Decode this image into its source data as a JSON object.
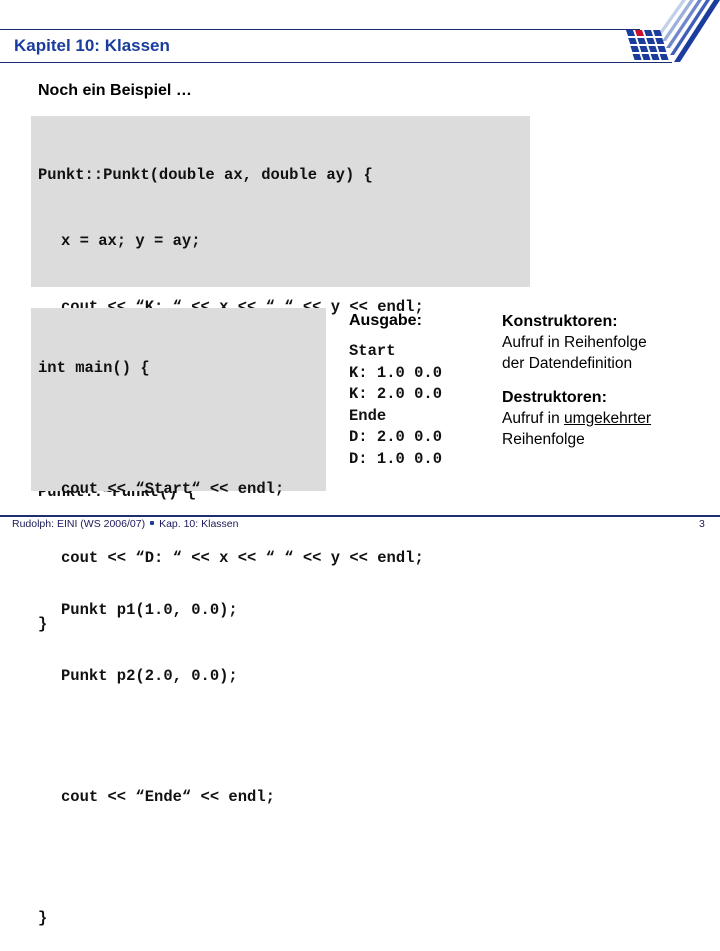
{
  "header": {
    "title": "Kapitel 10: Klassen"
  },
  "subtitle": "Noch ein Beispiel …",
  "code_constructor_destructor": [
    "Punkt::Punkt(double ax, double ay) {",
    "x = ax; y = ay;",
    "cout << “K: “ << x << “ “ << y << endl;",
    "}",
    "Punkt::~Punkt() {",
    "cout << “D: “ << x << “ “ << y << endl;",
    "}"
  ],
  "code_main": [
    "int main() {",
    "cout << “Start“ << endl;",
    "Punkt p1(1.0, 0.0);",
    "Punkt p2(2.0, 0.0);",
    "cout << “Ende“ << endl;",
    "}"
  ],
  "output": {
    "heading": "Ausgabe:",
    "lines": [
      "Start",
      "K: 1.0 0.0",
      "K: 2.0 0.0",
      "Ende",
      "D: 2.0 0.0",
      "D: 1.0 0.0"
    ]
  },
  "notes": {
    "constructors": {
      "heading": "Konstruktoren:",
      "line1": "Aufruf in Reihenfolge",
      "line2": "der Datendefinition"
    },
    "destructors": {
      "heading": "Destruktoren:",
      "line1_prefix": "Aufruf in ",
      "line1_underlined": "umgekehrter",
      "line2": "Reihenfolge"
    }
  },
  "footer": {
    "left_part1": "Rudolph: EINI (WS 2006/07)",
    "left_part2": "Kap. 10: Klassen",
    "page_number": "3"
  },
  "colors": {
    "title_blue": "#1a3c9c",
    "rule_navy": "#1c2f6e",
    "code_bg": "#dcdcdc",
    "logo_red": "#c8102e"
  }
}
